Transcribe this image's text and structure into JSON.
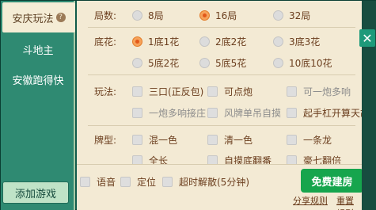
{
  "sidebar": {
    "tabs": [
      {
        "label": "安庆玩法",
        "help": "?"
      },
      {
        "label": "斗地主"
      },
      {
        "label": "安徽跑得快"
      }
    ],
    "add_game": "添加游戏"
  },
  "rounds": {
    "label": "局数:",
    "options": [
      "8局",
      "16局",
      "32局"
    ],
    "selected": "16局"
  },
  "base": {
    "label": "底花:",
    "options": [
      "1底1花",
      "2底2花",
      "3底3花",
      "5底2花",
      "5底5花",
      "10底10花"
    ],
    "selected": "1底1花"
  },
  "rules": {
    "label": "玩法:",
    "options": [
      "三口(正反包)",
      "可点炮",
      "可一炮多响",
      "一炮多响接庄",
      "风牌单吊自摸",
      "起手杠开算天胡"
    ]
  },
  "hands": {
    "label": "牌型:",
    "options": [
      "混一色",
      "清一色",
      "一条龙",
      "全长",
      "自摸底翻番",
      "豪七翻倍"
    ]
  },
  "footer": {
    "voice": "语音",
    "location": "定位",
    "timeout": "超时解散(5分钟)",
    "create": "免费建房",
    "share_rules": "分享规则",
    "reset_rules": "重置规则"
  },
  "close_icon": "close-icon"
}
